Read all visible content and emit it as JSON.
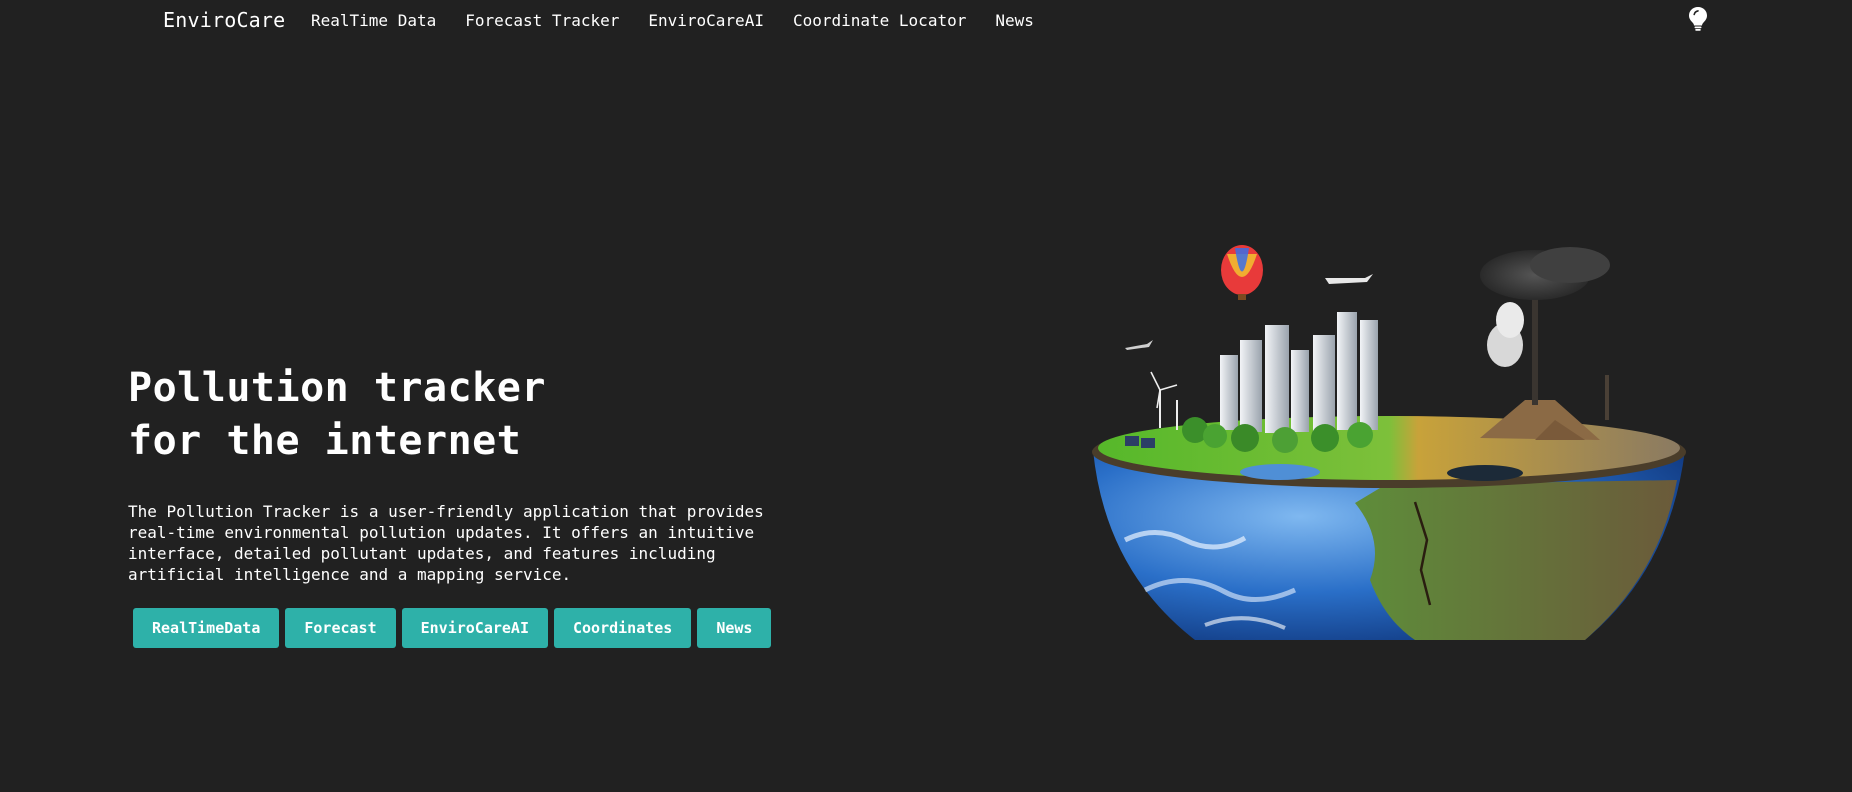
{
  "nav": {
    "brand": "EnviroCare",
    "links": [
      {
        "label": "RealTime Data"
      },
      {
        "label": "Forecast Tracker"
      },
      {
        "label": "EnviroCareAI"
      },
      {
        "label": "Coordinate Locator"
      },
      {
        "label": "News"
      }
    ],
    "theme_toggle_icon": "lightbulb-icon"
  },
  "hero": {
    "title_line1": "Pollution tracker",
    "title_line2": "for the internet",
    "description": "The Pollution Tracker is a user-friendly application that provides real-time environmental pollution updates. It offers an intuitive interface, detailed pollutant updates, and features including artificial intelligence and a mapping service.",
    "buttons": [
      {
        "label": "RealTimeData"
      },
      {
        "label": "Forecast"
      },
      {
        "label": "EnviroCareAI"
      },
      {
        "label": "Coordinates"
      },
      {
        "label": "News"
      }
    ]
  },
  "colors": {
    "background": "#212121",
    "accent": "#2eb1a9",
    "text": "#ffffff"
  },
  "illustration": {
    "subject": "half-earth-city-and-pollution-illustration"
  }
}
